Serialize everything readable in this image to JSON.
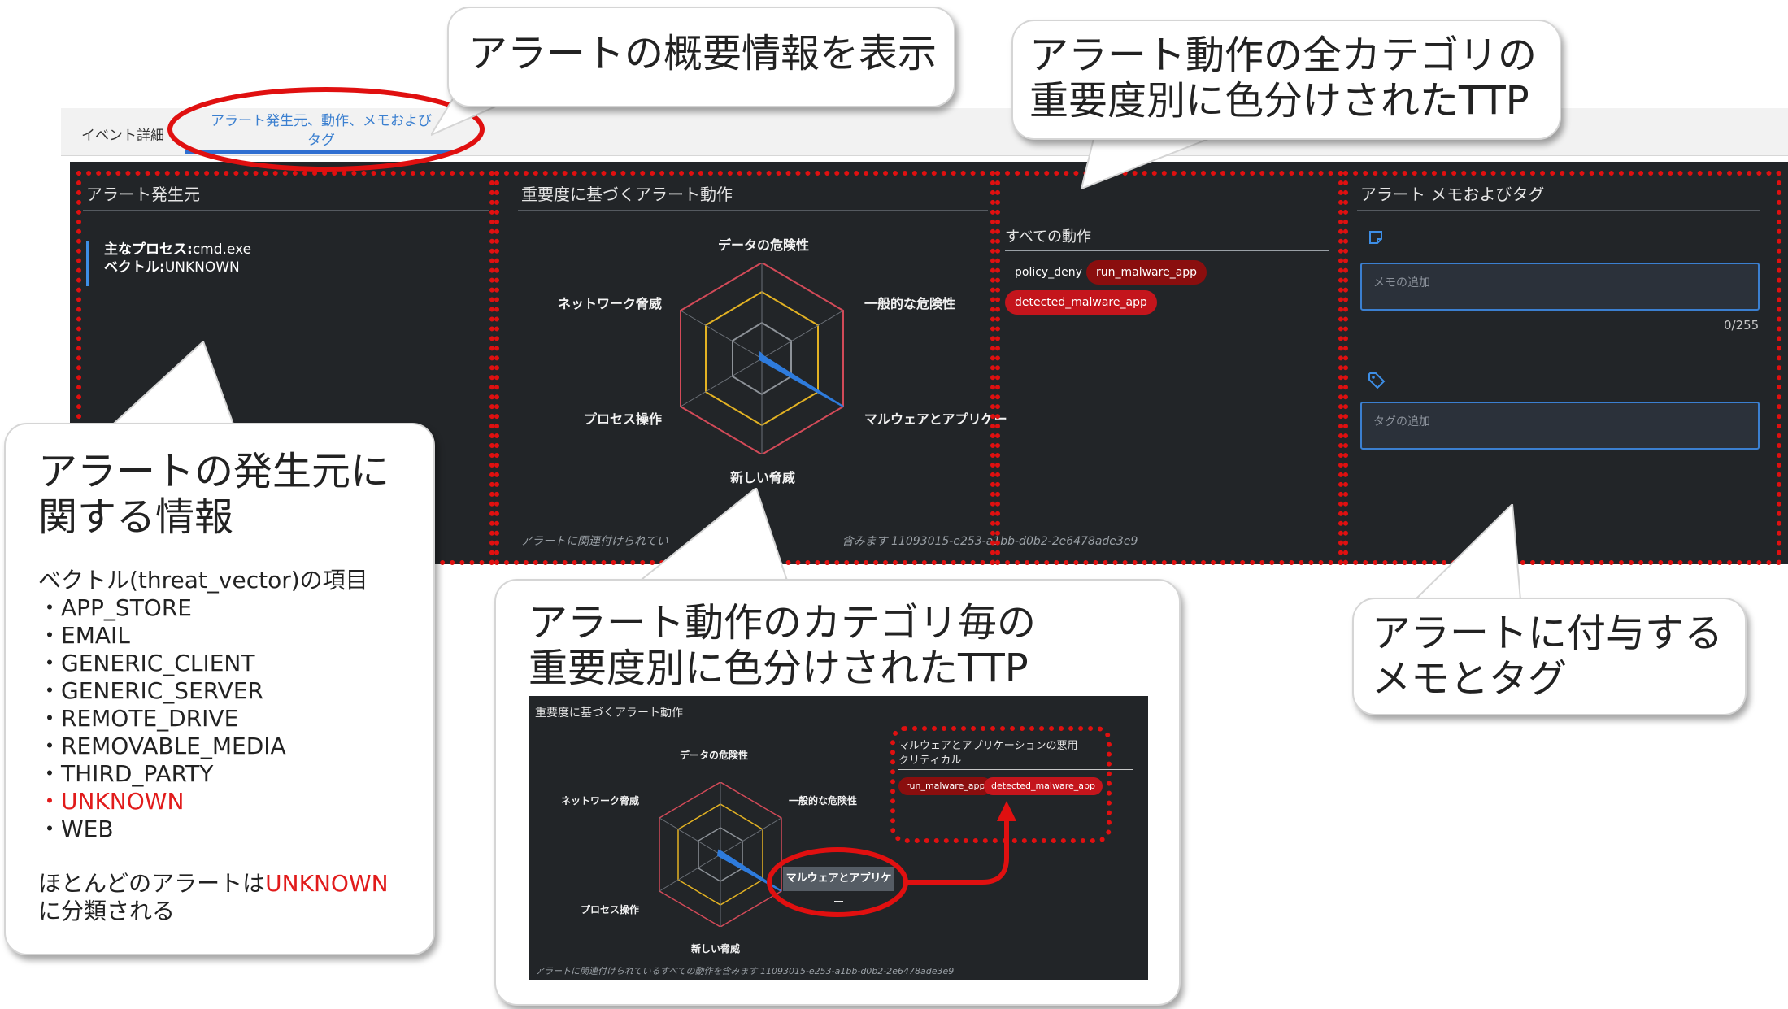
{
  "tabs": {
    "event_details": "イベント詳細",
    "origin_tab_line1": "アラート発生元、動作、メモおよび",
    "origin_tab_line2": "タグ"
  },
  "origin_panel": {
    "title": "アラート発生元",
    "process_label": "主なプロセス:",
    "process_value": "cmd.exe",
    "vector_label": "ベクトル:",
    "vector_value": "UNKNOWN"
  },
  "behavior_panel": {
    "title": "重要度に基づくアラート動作",
    "axes": {
      "top": "データの危険性",
      "upper_right": "一般的な危険性",
      "lower_right": "マルウェアとアプリケー",
      "bottom": "新しい脅威",
      "lower_left": "プロセス操作",
      "upper_left": "ネットワーク脅威"
    },
    "footer_prefix": "アラートに関連付けられてい",
    "footer_suffix": "含みます 11093015-e253-a1bb-d0b2-2e6478ade3e9"
  },
  "all_behaviors": {
    "title": "すべての動作",
    "chips": [
      "policy_deny",
      "run_malware_app",
      "detected_malware_app"
    ]
  },
  "memo_panel": {
    "title": "アラート メモおよびタグ",
    "memo_placeholder": "メモの追加",
    "memo_counter": "0/255",
    "tag_placeholder": "タグの追加"
  },
  "callouts": {
    "overview": "アラートの概要情報を表示",
    "all_categories_line1": "アラート動作の全カテゴリの",
    "all_categories_line2": "重要度別に色分けされたTTP",
    "origin_line1": "アラートの発生元に",
    "origin_line2": "関する情報",
    "vector_heading": "ベクトル(threat_vector)の項目",
    "vector_items": [
      "・APP_STORE",
      "・EMAIL",
      "・GENERIC_CLIENT",
      "・GENERIC_SERVER",
      "・REMOTE_DRIVE",
      "・REMOVABLE_MEDIA",
      "・THIRD_PARTY",
      "・UNKNOWN",
      "・WEB"
    ],
    "note_prefix": "ほとんどのアラートは",
    "note_highlight": "UNKNOWN",
    "note_line2": "に分類される",
    "per_category_line1": "アラート動作のカテゴリ毎の",
    "per_category_line2": "重要度別に色分けされたTTP",
    "memo_tag_line1": "アラートに付与する",
    "memo_tag_line2": "メモとタグ"
  },
  "inset": {
    "title": "重要度に基づくアラート動作",
    "axes": {
      "top": "データの危険性",
      "upper_right": "一般的な危険性",
      "bottom": "新しい脅威",
      "lower_left": "プロセス操作",
      "upper_left": "ネットワーク脅威"
    },
    "tooltip": "マルウェアとアプリケー",
    "category_line1": "マルウェアとアプリケーションの悪用",
    "category_line2": "クリティカル",
    "chips": [
      "run_malware_app",
      "detected_malware_app"
    ],
    "footer": "アラートに関連付けられているすべての動作を含みます 11093015-e253-a1bb-d0b2-2e6478ade3e9"
  },
  "colors": {
    "panel_bg": "#222528",
    "accent_blue": "#2f6fd1",
    "critical_red": "#c4151c",
    "outer_ring": "#d24a58",
    "middle_ring": "#e3b223",
    "inner_ring": "#8d9298"
  }
}
